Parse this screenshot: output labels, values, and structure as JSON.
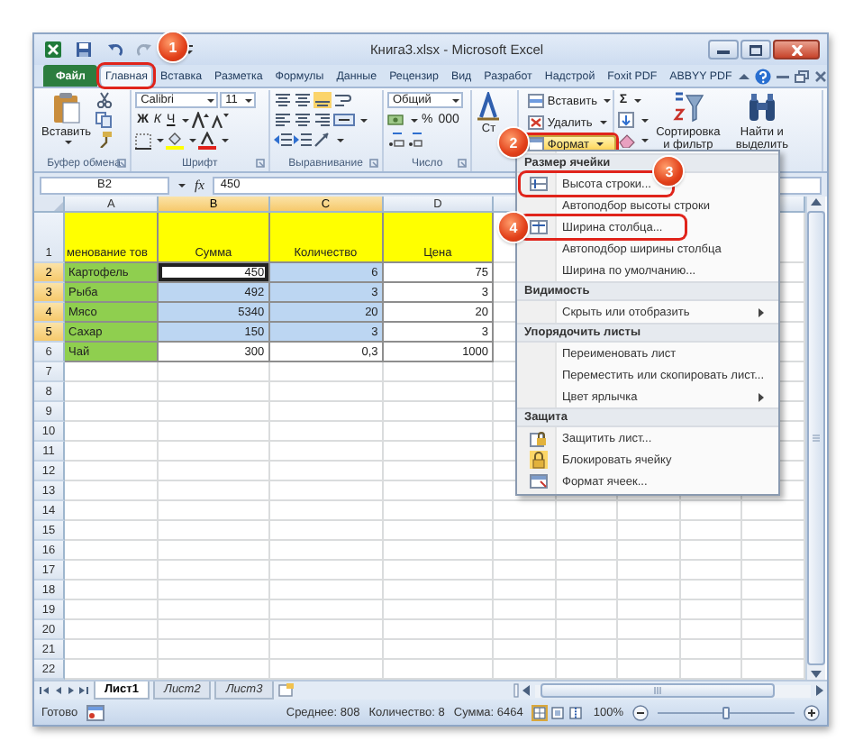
{
  "window": {
    "title": "Книга3.xlsx - Microsoft Excel"
  },
  "ribbon_tabs": [
    {
      "label": "Файл",
      "kind": "file",
      "selected": false,
      "highlighted": false
    },
    {
      "label": "Главная",
      "kind": "tab",
      "selected": true,
      "highlighted": true,
      "callout": "1"
    },
    {
      "label": "Вставка",
      "kind": "tab",
      "selected": false,
      "highlighted": false
    },
    {
      "label": "Разметка",
      "kind": "tab",
      "selected": false,
      "highlighted": false
    },
    {
      "label": "Формулы",
      "kind": "tab",
      "selected": false,
      "highlighted": false
    },
    {
      "label": "Данные",
      "kind": "tab",
      "selected": false,
      "highlighted": false
    },
    {
      "label": "Рецензир",
      "kind": "tab",
      "selected": false,
      "highlighted": false
    },
    {
      "label": "Вид",
      "kind": "tab",
      "selected": false,
      "highlighted": false
    },
    {
      "label": "Разработ",
      "kind": "tab",
      "selected": false,
      "highlighted": false
    },
    {
      "label": "Надстрой",
      "kind": "tab",
      "selected": false,
      "highlighted": false
    },
    {
      "label": "Foxit PDF",
      "kind": "tab",
      "selected": false,
      "highlighted": false
    },
    {
      "label": "ABBYY PDF",
      "kind": "tab",
      "selected": false,
      "highlighted": false
    }
  ],
  "ribbon_groups": [
    {
      "kind": "clipboard",
      "label": "Буфер обмена",
      "paste": "Вставить"
    },
    {
      "kind": "font",
      "label": "Шрифт",
      "font": "Calibri",
      "size": "11",
      "bold": "Ж",
      "italic": "К",
      "underline": "Ч"
    },
    {
      "kind": "alignment",
      "label": "Выравнивание"
    },
    {
      "kind": "number",
      "label": "Число",
      "format": "Общий",
      "percent": "%",
      "thousands": "000"
    },
    {
      "kind": "styles",
      "button": "Ст"
    },
    {
      "kind": "cells",
      "insert": "Вставить",
      "delete": "Удалить",
      "format": "Формат",
      "format_highlighted": true,
      "callout": "2"
    },
    {
      "kind": "editing",
      "autosum": "Σ",
      "sort": "Сортировка и фильтр",
      "find": "Найти и выделить"
    }
  ],
  "formula_bar": {
    "name_box": "B2",
    "fx": "fx",
    "value": "450"
  },
  "columns": [
    {
      "label": "A",
      "selected": false
    },
    {
      "label": "B",
      "selected": true
    },
    {
      "label": "C",
      "selected": true
    },
    {
      "label": "D",
      "selected": false
    }
  ],
  "rows": [
    {
      "number": "1",
      "kind": "heading",
      "selected": false,
      "cells": [
        {
          "text": "менование тов",
          "kind": "name",
          "selected": false,
          "active": false
        },
        {
          "text": "Сумма",
          "kind": "number",
          "selected": false,
          "active": false
        },
        {
          "text": "Количество",
          "kind": "number",
          "selected": false,
          "active": false
        },
        {
          "text": "Цена",
          "kind": "number",
          "selected": false,
          "active": false
        }
      ]
    },
    {
      "number": "2",
      "kind": "data",
      "selected": true,
      "cells": [
        {
          "text": "Картофель",
          "kind": "name",
          "selected": false,
          "active": false
        },
        {
          "text": "450",
          "kind": "number",
          "selected": true,
          "active": true
        },
        {
          "text": "6",
          "kind": "number",
          "selected": true,
          "active": false
        },
        {
          "text": "75",
          "kind": "number",
          "selected": false,
          "active": false
        }
      ]
    },
    {
      "number": "3",
      "kind": "data",
      "selected": true,
      "cells": [
        {
          "text": "Рыба",
          "kind": "name",
          "selected": false,
          "active": false
        },
        {
          "text": "492",
          "kind": "number",
          "selected": true,
          "active": false
        },
        {
          "text": "3",
          "kind": "number",
          "selected": true,
          "active": false
        },
        {
          "text": "3",
          "kind": "number",
          "selected": false,
          "active": false
        }
      ]
    },
    {
      "number": "4",
      "kind": "data",
      "selected": true,
      "cells": [
        {
          "text": "Мясо",
          "kind": "name",
          "selected": false,
          "active": false
        },
        {
          "text": "5340",
          "kind": "number",
          "selected": true,
          "active": false
        },
        {
          "text": "20",
          "kind": "number",
          "selected": true,
          "active": false
        },
        {
          "text": "20",
          "kind": "number",
          "selected": false,
          "active": false
        }
      ]
    },
    {
      "number": "5",
      "kind": "data",
      "selected": true,
      "cells": [
        {
          "text": "Сахар",
          "kind": "name",
          "selected": false,
          "active": false
        },
        {
          "text": "150",
          "kind": "number",
          "selected": true,
          "active": false
        },
        {
          "text": "3",
          "kind": "number",
          "selected": true,
          "active": false
        },
        {
          "text": "3",
          "kind": "number",
          "selected": false,
          "active": false
        }
      ]
    },
    {
      "number": "6",
      "kind": "data",
      "selected": false,
      "cells": [
        {
          "text": "Чай",
          "kind": "name",
          "selected": false,
          "active": false
        },
        {
          "text": "300",
          "kind": "number",
          "selected": false,
          "active": false
        },
        {
          "text": "0,3",
          "kind": "number",
          "selected": false,
          "active": false
        },
        {
          "text": "1000",
          "kind": "number",
          "selected": false,
          "active": false
        }
      ]
    },
    {
      "number": "7",
      "kind": "empty",
      "selected": false
    },
    {
      "number": "8",
      "kind": "empty",
      "selected": false
    },
    {
      "number": "9",
      "kind": "empty",
      "selected": false
    },
    {
      "number": "10",
      "kind": "empty",
      "selected": false
    },
    {
      "number": "11",
      "kind": "empty",
      "selected": false
    },
    {
      "number": "12",
      "kind": "empty",
      "selected": false
    },
    {
      "number": "13",
      "kind": "empty",
      "selected": false
    },
    {
      "number": "14",
      "kind": "empty",
      "selected": false
    },
    {
      "number": "15",
      "kind": "empty",
      "selected": false
    },
    {
      "number": "16",
      "kind": "empty",
      "selected": false
    },
    {
      "number": "17",
      "kind": "empty",
      "selected": false
    },
    {
      "number": "18",
      "kind": "empty",
      "selected": false
    },
    {
      "number": "19",
      "kind": "empty",
      "selected": false
    },
    {
      "number": "20",
      "kind": "empty",
      "selected": false
    },
    {
      "number": "21",
      "kind": "empty",
      "selected": false
    },
    {
      "number": "22",
      "kind": "empty",
      "selected": false
    }
  ],
  "menu": {
    "items": [
      {
        "kind": "header",
        "label": "Размер ячейки"
      },
      {
        "kind": "row-height",
        "label": "Высота строки...",
        "highlighted": true,
        "callout": "3",
        "submenu": false,
        "checked": false
      },
      {
        "kind": "item",
        "label": "Автоподбор высоты строки",
        "highlighted": false,
        "submenu": false,
        "checked": false
      },
      {
        "kind": "column-width",
        "label": "Ширина столбца...",
        "highlighted": true,
        "callout": "4",
        "submenu": false,
        "checked": false
      },
      {
        "kind": "item",
        "label": "Автоподбор ширины столбца",
        "highlighted": false,
        "submenu": false,
        "checked": false
      },
      {
        "kind": "item",
        "label": "Ширина по умолчанию...",
        "highlighted": false,
        "submenu": false,
        "checked": false
      },
      {
        "kind": "header",
        "label": "Видимость"
      },
      {
        "kind": "item",
        "label": "Скрыть или отобразить",
        "highlighted": false,
        "submenu": true,
        "checked": false
      },
      {
        "kind": "header",
        "label": "Упорядочить листы"
      },
      {
        "kind": "item",
        "label": "Переименовать лист",
        "highlighted": false,
        "submenu": false,
        "checked": false
      },
      {
        "kind": "item",
        "label": "Переместить или скопировать лист...",
        "highlighted": false,
        "submenu": false,
        "checked": false
      },
      {
        "kind": "item",
        "label": "Цвет ярлычка",
        "highlighted": false,
        "submenu": true,
        "checked": false
      },
      {
        "kind": "header",
        "label": "Защита"
      },
      {
        "kind": "protect",
        "label": "Защитить лист...",
        "highlighted": false,
        "submenu": false,
        "checked": false
      },
      {
        "kind": "lock",
        "label": "Блокировать ячейку",
        "highlighted": false,
        "submenu": false,
        "checked": true
      },
      {
        "kind": "format",
        "label": "Формат ячеек...",
        "highlighted": false,
        "submenu": false,
        "checked": false
      }
    ]
  },
  "sheet_tabs": [
    {
      "label": "Лист1",
      "selected": true
    },
    {
      "label": "Лист2",
      "selected": false
    },
    {
      "label": "Лист3",
      "selected": false
    }
  ],
  "status_bar": {
    "ready": "Готово",
    "average": "Среднее: 808",
    "count": "Количество: 8",
    "sum": "Сумма: 6464",
    "views": [
      {
        "kind": "normal",
        "selected": true
      },
      {
        "kind": "layout",
        "selected": false
      },
      {
        "kind": "pagebreak",
        "selected": false
      }
    ],
    "zoom": "100%",
    "zoom_slider": {
      "level": 0.5
    }
  }
}
